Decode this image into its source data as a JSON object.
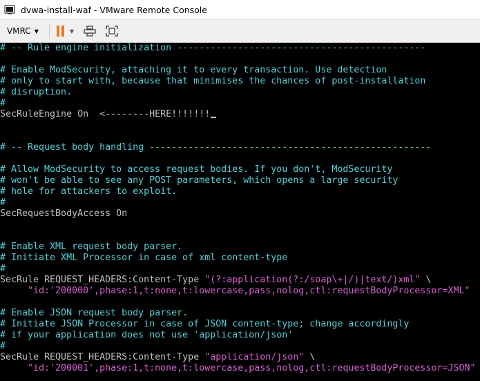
{
  "window": {
    "title": "dvwa-install-waf - VMware Remote Console"
  },
  "toolbar": {
    "menu_label": "VMRC",
    "icons": [
      "vmrc-dropdown",
      "pause-icon",
      "pause-options-icon",
      "send-ctrl-alt-del-icon",
      "fullscreen-icon"
    ],
    "pause_color": "#f07820"
  },
  "terminal": {
    "colors": {
      "text": "#c0c0c0",
      "comment": "#55d0d8",
      "string": "#d860d0",
      "background": "#000000"
    },
    "lines": [
      [
        [
          "c",
          "# -- Rule engine initialization ---------------------------------------------"
        ]
      ],
      [],
      [
        [
          "c",
          "# Enable ModSecurity, attaching it to every transaction. Use detection"
        ]
      ],
      [
        [
          "c",
          "# only to start with, because that minimises the chances of post-installation"
        ]
      ],
      [
        [
          "c",
          "# disruption."
        ]
      ],
      [
        [
          "c",
          "#"
        ]
      ],
      [
        [
          "n",
          "SecRuleEngine On  <--------HERE!!!!!!!"
        ]
      ],
      [],
      [],
      [
        [
          "c",
          "# -- Request body handling ---------------------------------------------------"
        ]
      ],
      [],
      [
        [
          "c",
          "# Allow ModSecurity to access request bodies. If you don't, ModSecurity"
        ]
      ],
      [
        [
          "c",
          "# won't be able to see any POST parameters, which opens a large security"
        ]
      ],
      [
        [
          "c",
          "# hole for attackers to exploit."
        ]
      ],
      [
        [
          "c",
          "#"
        ]
      ],
      [
        [
          "n",
          "SecRequestBodyAccess On"
        ]
      ],
      [],
      [],
      [
        [
          "c",
          "# Enable XML request body parser."
        ]
      ],
      [
        [
          "c",
          "# Initiate XML Processor in case of xml content-type"
        ]
      ],
      [
        [
          "c",
          "#"
        ]
      ],
      [
        [
          "n",
          "SecRule REQUEST_HEADERS:Content-Type "
        ],
        [
          "s",
          "\"(?:application(?:/soap\\+|/)|text/)xml\""
        ],
        [
          "n",
          " \\"
        ]
      ],
      [
        [
          "s",
          "     \"id:'200000',phase:1,t:none,t:lowercase,pass,nolog,ctl:requestBodyProcessor=XML\""
        ]
      ],
      [],
      [
        [
          "c",
          "# Enable JSON request body parser."
        ]
      ],
      [
        [
          "c",
          "# Initiate JSON Processor in case of JSON content-type; change accordingly"
        ]
      ],
      [
        [
          "c",
          "# if your application does not use 'application/json'"
        ]
      ],
      [
        [
          "c",
          "#"
        ]
      ],
      [
        [
          "n",
          "SecRule REQUEST_HEADERS:Content-Type "
        ],
        [
          "s",
          "\"application/json\""
        ],
        [
          "n",
          " \\"
        ]
      ],
      [
        [
          "s",
          "     \"id:'200001',phase:1,t:none,t:lowercase,pass,nolog,ctl:requestBodyProcessor=JSON\""
        ]
      ]
    ],
    "cursor_line": 6
  }
}
